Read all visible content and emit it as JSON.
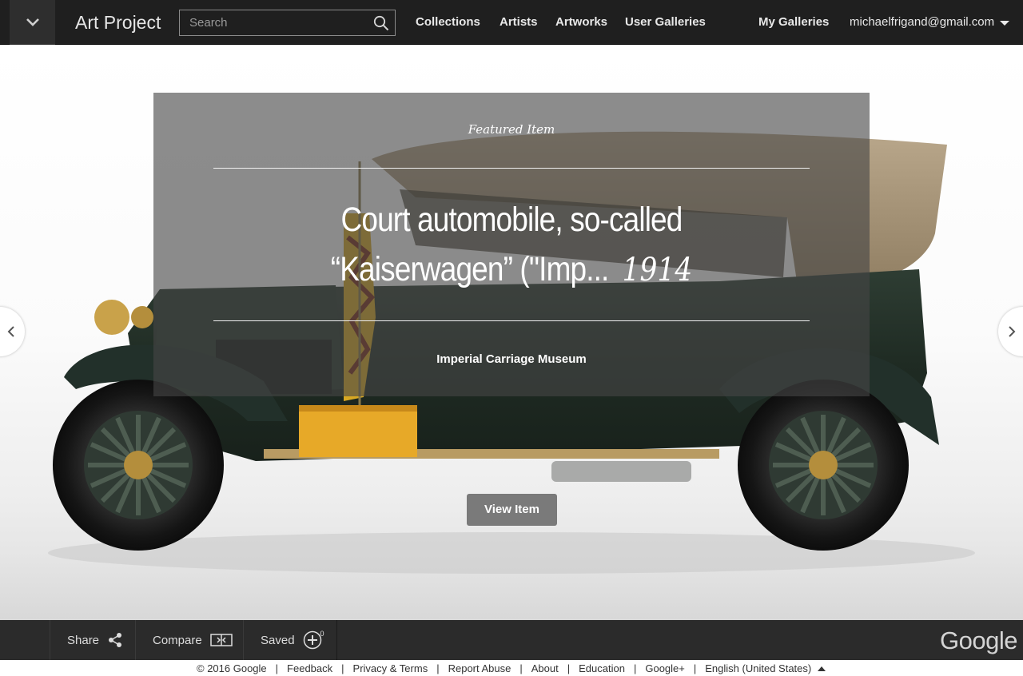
{
  "header": {
    "app_title": "Art Project",
    "search": {
      "placeholder": "Search",
      "value": ""
    },
    "nav": [
      "Collections",
      "Artists",
      "Artworks",
      "User Galleries"
    ],
    "my_galleries": "My Galleries",
    "account_email": "michaelfrigand@gmail.com"
  },
  "featured": {
    "label": "Featured Item",
    "title_line1": "Court automobile, so-called",
    "title_line2": "“Kaiserwagen” (\"Imp...",
    "year": "1914",
    "museum": "Imperial Carriage Museum",
    "view_button": "View Item"
  },
  "toolbar": {
    "share": "Share",
    "compare": "Compare",
    "saved": "Saved",
    "saved_count": "0",
    "brand": "Google"
  },
  "footer": {
    "links": [
      "© 2016 Google",
      "Feedback",
      "Privacy & Terms",
      "Report Abuse",
      "About",
      "Education",
      "Google+",
      "English (United States)"
    ]
  },
  "colors": {
    "topbar": "#1f1f1f",
    "bottombar": "#2b2b2b",
    "panel_overlay": "rgba(70,70,70,0.62)",
    "car_body": "#243228",
    "car_top": "#a8967a"
  }
}
